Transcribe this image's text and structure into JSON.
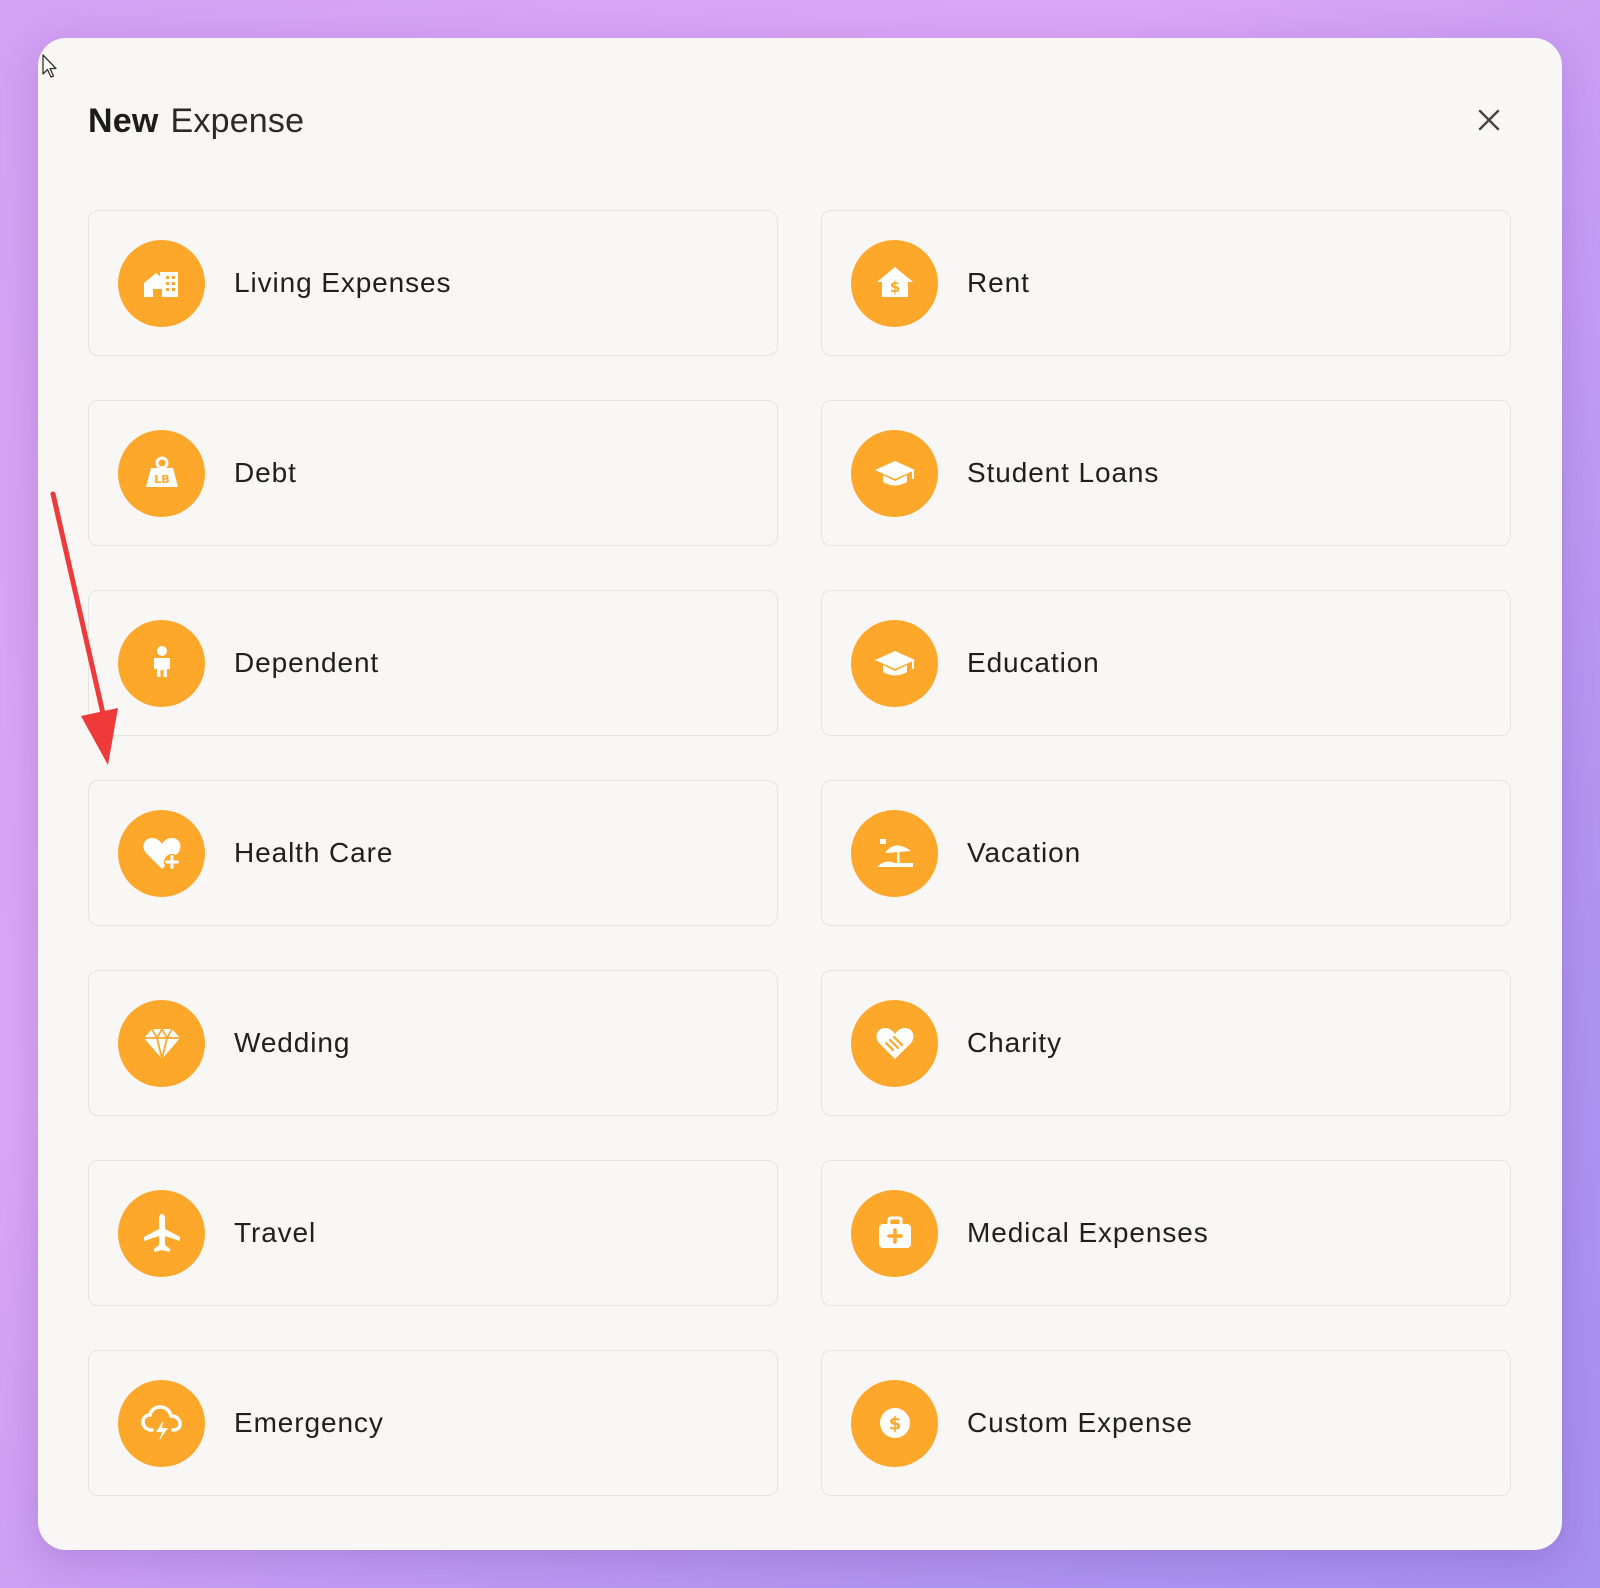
{
  "dialog": {
    "title_bold": "New",
    "title_light": "Expense",
    "close_icon": "close-icon"
  },
  "accent_color": "#fda72b",
  "annotation_color": "#ee3a3a",
  "categories": [
    {
      "label": "Living Expenses",
      "icon": "building-icon"
    },
    {
      "label": "Rent",
      "icon": "house-dollar-icon"
    },
    {
      "label": "Debt",
      "icon": "weight-lb-icon"
    },
    {
      "label": "Student Loans",
      "icon": "graduation-cap-icon"
    },
    {
      "label": "Dependent",
      "icon": "child-icon"
    },
    {
      "label": "Education",
      "icon": "graduation-cap-icon"
    },
    {
      "label": "Health Care",
      "icon": "heart-plus-icon"
    },
    {
      "label": "Vacation",
      "icon": "beach-umbrella-icon"
    },
    {
      "label": "Wedding",
      "icon": "diamond-icon"
    },
    {
      "label": "Charity",
      "icon": "heart-handshake-icon"
    },
    {
      "label": "Travel",
      "icon": "airplane-icon"
    },
    {
      "label": "Medical Expenses",
      "icon": "medical-kit-icon"
    },
    {
      "label": "Emergency",
      "icon": "storm-cloud-icon"
    },
    {
      "label": "Custom Expense",
      "icon": "dollar-circle-icon"
    }
  ]
}
